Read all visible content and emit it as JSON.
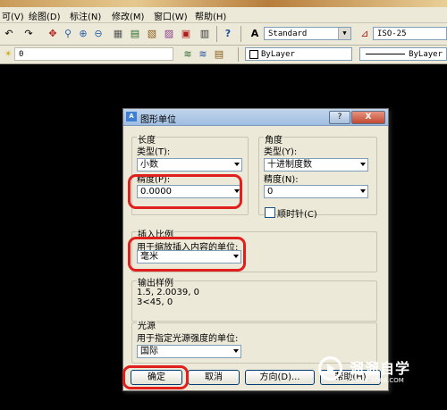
{
  "menubar": {
    "items": [
      "可(V)",
      "绘图(D)",
      "标注(N)",
      "修改(M)",
      "窗口(W)",
      "帮助(H)"
    ]
  },
  "toolbar": {
    "text_style": "Standard",
    "dim_style": "ISO-25",
    "layer_value": "0",
    "color": "ByLayer",
    "linetype": "ByLayer"
  },
  "dialog": {
    "title": "图形单位",
    "help_glyph": "?",
    "close_glyph": "X",
    "length": {
      "group_label": "长度",
      "type_label": "类型(T):",
      "type_value": "小数",
      "precision_label": "精度(P):",
      "precision_value": "0.0000"
    },
    "angle": {
      "group_label": "角度",
      "type_label": "类型(Y):",
      "type_value": "十进制度数",
      "precision_label": "精度(N):",
      "precision_value": "0",
      "clockwise_label": "顺时针(C)",
      "clockwise_checked": false
    },
    "insert_scale": {
      "group_label": "插入比例",
      "units_label": "用于缩放插入内容的单位:",
      "units_value": "毫米"
    },
    "sample_output": {
      "group_label": "输出样例",
      "line1": "1.5, 2.0039, 0",
      "line2": "3<45, 0"
    },
    "lighting": {
      "group_label": "光源",
      "units_label": "用于指定光源强度的单位:",
      "units_value": "国际"
    },
    "buttons": {
      "ok": "确定",
      "cancel": "取消",
      "direction": "方向(D)...",
      "help": "帮助(H)"
    }
  },
  "watermark": {
    "brand": "溜溜自学",
    "url": "ZIXUE.3D66.COM"
  },
  "colors": {
    "highlight": "#e0201c",
    "title_bar": "#9fbde2",
    "dialog_bg": "#ece9d8"
  }
}
